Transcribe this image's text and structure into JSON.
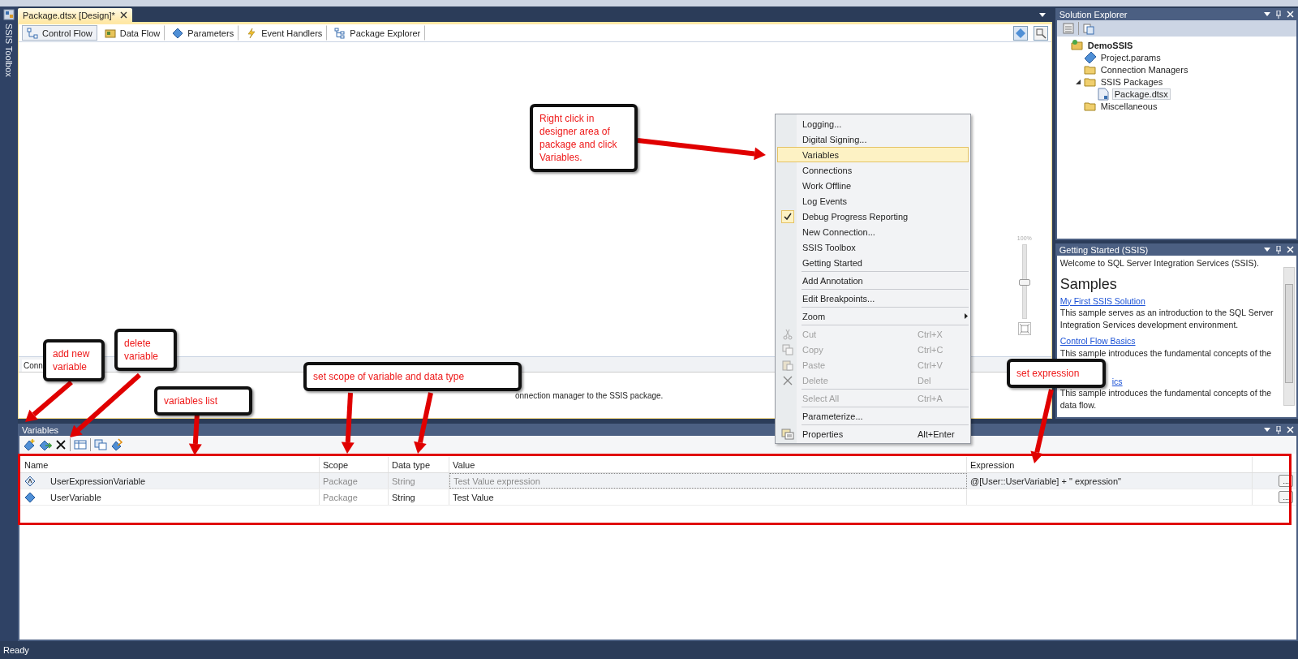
{
  "toolbox": {
    "label": "SSIS Toolbox"
  },
  "document_tab": {
    "title": "Package.dtsx [Design]*",
    "selected": true
  },
  "designer_tabs": [
    {
      "label": "Control Flow",
      "kind": "control-flow",
      "selected": true
    },
    {
      "label": "Data Flow",
      "kind": "data-flow",
      "selected": false
    },
    {
      "label": "Parameters",
      "kind": "parameters",
      "selected": false
    },
    {
      "label": "Event Handlers",
      "kind": "event-handlers",
      "selected": false
    },
    {
      "label": "Package Explorer",
      "kind": "package-explorer",
      "selected": false
    }
  ],
  "zoom_slider": {
    "label": "100%",
    "level": 0.5
  },
  "connection_managers": {
    "tab": "Conn",
    "message": "onnection manager to the SSIS package."
  },
  "context_menu": {
    "groups": [
      [
        {
          "label": "Logging...",
          "kind": "plain",
          "selected": false,
          "checked": false,
          "disabled": false
        },
        {
          "label": "Digital Signing...",
          "kind": "plain",
          "selected": false,
          "checked": false,
          "disabled": false
        },
        {
          "label": "Variables",
          "kind": "plain",
          "selected": true,
          "checked": false,
          "disabled": false
        },
        {
          "label": "Connections",
          "kind": "plain",
          "selected": false,
          "checked": false,
          "disabled": false
        },
        {
          "label": "Work Offline",
          "kind": "plain",
          "selected": false,
          "checked": false,
          "disabled": false
        },
        {
          "label": "Log Events",
          "kind": "plain",
          "selected": false,
          "checked": false,
          "disabled": false
        },
        {
          "label": "Debug Progress Reporting",
          "kind": "plain",
          "selected": false,
          "checked": true,
          "disabled": false
        },
        {
          "label": "New Connection...",
          "kind": "plain",
          "selected": false,
          "checked": false,
          "disabled": false
        },
        {
          "label": "SSIS Toolbox",
          "kind": "plain",
          "selected": false,
          "checked": false,
          "disabled": false
        },
        {
          "label": "Getting Started",
          "kind": "plain",
          "selected": false,
          "checked": false,
          "disabled": false
        }
      ],
      [
        {
          "label": "Add Annotation",
          "kind": "plain",
          "selected": false,
          "checked": false,
          "disabled": false
        }
      ],
      [
        {
          "label": "Edit Breakpoints...",
          "kind": "plain",
          "selected": false,
          "checked": false,
          "disabled": false
        }
      ],
      [
        {
          "label": "Zoom",
          "kind": "submenu",
          "selected": false,
          "checked": false,
          "disabled": false
        }
      ],
      [
        {
          "label": "Cut",
          "shortcut": "Ctrl+X",
          "kind": "cut",
          "selected": false,
          "checked": false,
          "disabled": true
        },
        {
          "label": "Copy",
          "shortcut": "Ctrl+C",
          "kind": "copy",
          "selected": false,
          "checked": false,
          "disabled": true
        },
        {
          "label": "Paste",
          "shortcut": "Ctrl+V",
          "kind": "paste",
          "selected": false,
          "checked": false,
          "disabled": true
        },
        {
          "label": "Delete",
          "shortcut": "Del",
          "kind": "delete",
          "selected": false,
          "checked": false,
          "disabled": true
        }
      ],
      [
        {
          "label": "Select All",
          "shortcut": "Ctrl+A",
          "kind": "plain",
          "selected": false,
          "checked": false,
          "disabled": true
        }
      ],
      [
        {
          "label": "Parameterize...",
          "kind": "plain",
          "selected": false,
          "checked": false,
          "disabled": false
        }
      ],
      [
        {
          "label": "Properties",
          "shortcut": "Alt+Enter",
          "kind": "properties",
          "selected": false,
          "checked": false,
          "disabled": false
        }
      ]
    ]
  },
  "solution_explorer": {
    "title": "Solution Explorer",
    "tree": [
      {
        "label": "DemoSSIS",
        "kind": "project",
        "selected": false,
        "children": [
          {
            "label": "Project.params",
            "kind": "params",
            "selected": false
          },
          {
            "label": "Connection Managers",
            "kind": "folder",
            "selected": false
          },
          {
            "label": "SSIS Packages",
            "kind": "folder",
            "selected": false,
            "expanded": true,
            "children": [
              {
                "label": "Package.dtsx",
                "kind": "package",
                "selected": true
              }
            ]
          },
          {
            "label": "Miscellaneous",
            "kind": "folder",
            "selected": false
          }
        ]
      }
    ]
  },
  "getting_started": {
    "title": "Getting Started (SSIS)",
    "welcome": "Welcome to SQL Server Integration Services (SSIS).",
    "heading": "Samples",
    "samples": [
      {
        "link": "My First SSIS Solution",
        "description": "This sample serves as an introduction to the SQL Server Integration Services development environment."
      },
      {
        "link": "Control Flow Basics",
        "description": "This sample introduces the fundamental concepts of the"
      },
      {
        "link": "ics",
        "description": "This sample introduces the fundamental concepts of the data flow."
      }
    ]
  },
  "variables": {
    "title": "Variables",
    "columns": [
      "Name",
      "Scope",
      "Data type",
      "Value",
      "Expression"
    ],
    "rows": [
      {
        "kind": "expression",
        "name": "UserExpressionVariable",
        "scope": "Package",
        "data_type": "String",
        "value": "Test Value expression",
        "expression": "@[User::UserVariable] + \" expression\"",
        "button": "...",
        "selected": true,
        "readonly": true
      },
      {
        "kind": "plain",
        "name": "UserVariable",
        "scope": "Package",
        "data_type": "String",
        "value": "Test Value",
        "button": "...",
        "selected": false,
        "readonly": false
      }
    ]
  },
  "annotations": [
    {
      "text": "Right click in designer area of package and click Variables."
    },
    {
      "text": "add new variable"
    },
    {
      "text": "delete variable"
    },
    {
      "text": "variables list"
    },
    {
      "text": "set scope of variable and data type"
    },
    {
      "text": "set expression"
    }
  ],
  "status_bar": {
    "text": "Ready"
  }
}
